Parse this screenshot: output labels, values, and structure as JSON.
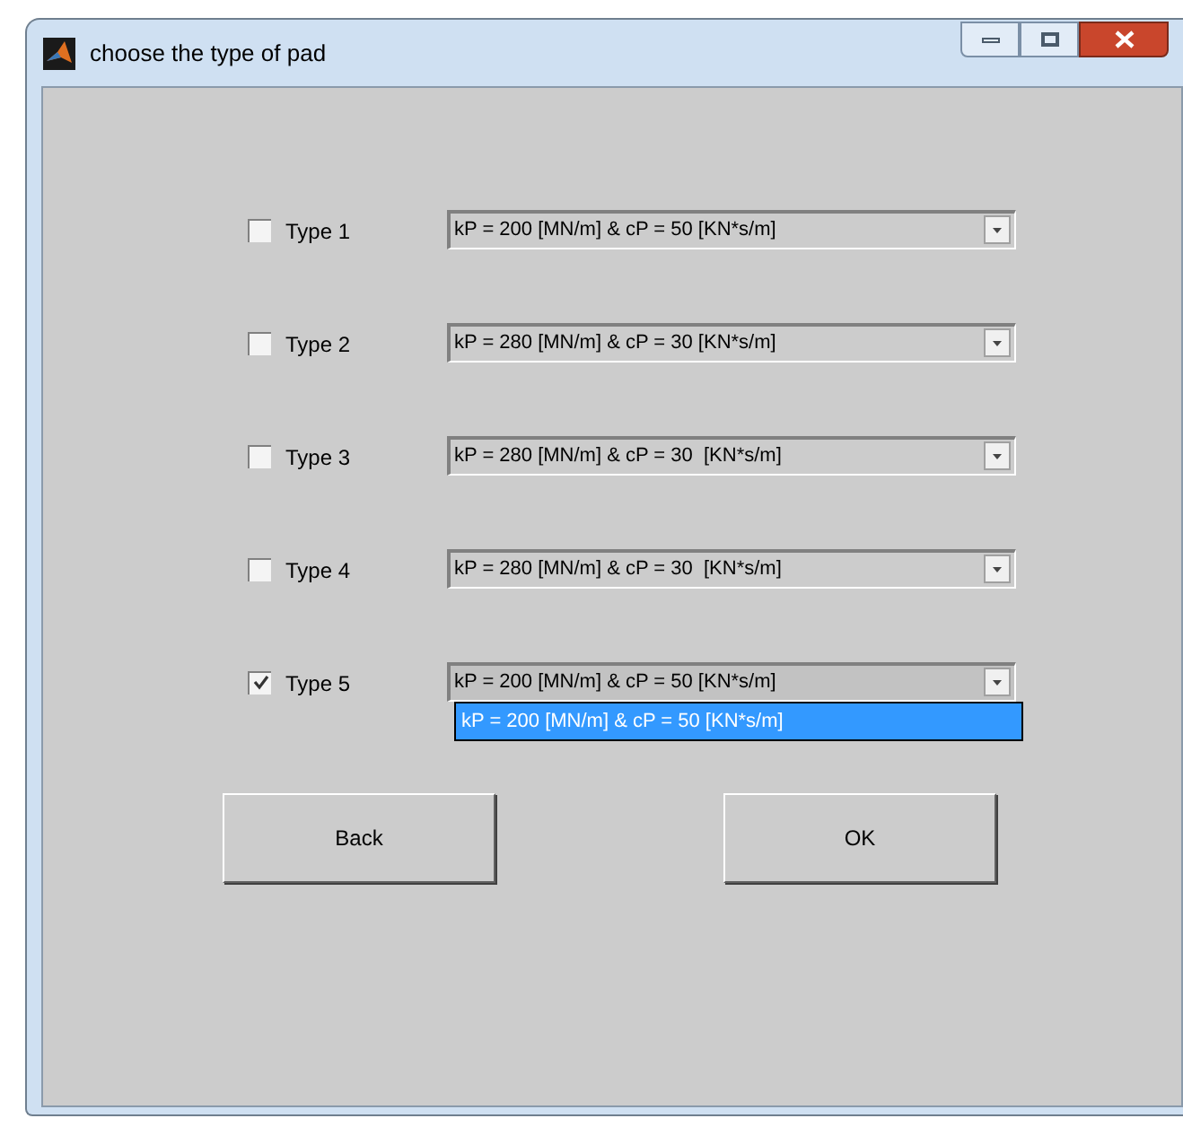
{
  "window": {
    "title": "choose the type of pad"
  },
  "options": [
    {
      "label": "Type 1",
      "checked": false,
      "dropdown": {
        "value": "kP = 200 [MN/m] & cP = 50 [KN*s/m]"
      }
    },
    {
      "label": "Type 2",
      "checked": false,
      "dropdown": {
        "value": "kP = 280 [MN/m] & cP = 30 [KN*s/m]"
      }
    },
    {
      "label": "Type 3",
      "checked": false,
      "dropdown": {
        "value": "kP = 280 [MN/m] & cP = 30  [KN*s/m]"
      }
    },
    {
      "label": "Type 4",
      "checked": false,
      "dropdown": {
        "value": "kP = 280 [MN/m] & cP = 30  [KN*s/m]"
      }
    },
    {
      "label": "Type 5",
      "checked": true,
      "dropdown": {
        "value": "kP = 200 [MN/m] & cP = 50 [KN*s/m]",
        "expanded": true,
        "items": [
          {
            "label": "kP = 200 [MN/m] & cP = 50 [KN*s/m]",
            "selected": true
          }
        ]
      }
    }
  ],
  "buttons": [
    "Back",
    "OK"
  ]
}
